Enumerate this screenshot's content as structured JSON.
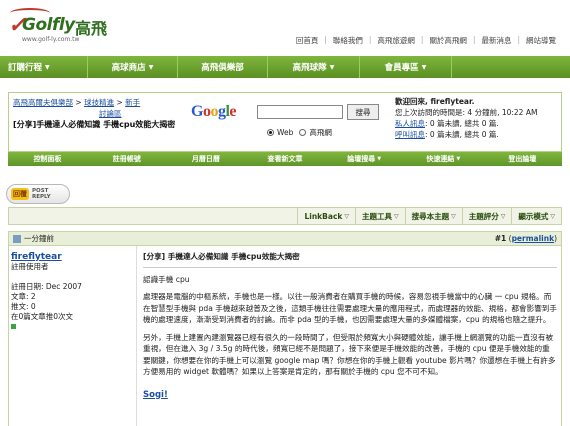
{
  "logo": {
    "word": "Golfly",
    "cjk": "高飛",
    "url": "www.golf-ly.com.tw"
  },
  "toplinks": [
    "回首頁",
    "聯絡我們",
    "高飛旅遊網",
    "關於高飛網",
    "最新消息",
    "網站導覽"
  ],
  "mainnav": [
    {
      "label": "訂購行程"
    },
    {
      "label": "高球商店"
    },
    {
      "label": "高飛俱樂部"
    },
    {
      "label": "高飛球隊"
    },
    {
      "label": "會員專區"
    }
  ],
  "breadcrumb": {
    "home": "高飛高爾夫俱樂部",
    "sep": ">",
    "forum": "球技精進",
    "section_prefix": "新手",
    "section_suffix": "討論區",
    "title": "[分享]手機達人必備知識  手機cpu效能大揭密"
  },
  "search": {
    "logo": {
      "g1": "G",
      "o1": "o",
      "o2": "o",
      "g2": "g",
      "l": "l",
      "e": "e"
    },
    "button": "搜尋",
    "query": "",
    "opt_web": "Web",
    "opt_site": "高飛網"
  },
  "user": {
    "welcome": "歡迎回來, fireflytear.",
    "last_visit": "您上次訪問的時間是: 4 分鐘前, 10:22 AM",
    "pm_label": "私人訊息",
    "pm_stats": ": 0 篇未讀, 總共 0 篇.",
    "call_label": "呼叫訊息",
    "call_stats": ": 0 篇未讀, 總共 0 篇."
  },
  "subnav": [
    "控制面板",
    "註冊帳號",
    "月曆日曆",
    "查看新文章",
    "論壇搜尋",
    "快速連結",
    "登出論壇"
  ],
  "post_reply": {
    "cjk": "回覆",
    "en1": "POST",
    "en2": "REPLY"
  },
  "thread_tools": [
    "LinkBack",
    "主題工具",
    "搜尋本主題",
    "主題評分",
    "顯示模式"
  ],
  "post": {
    "time": "一分鐘前",
    "number_prefix": "#1",
    "permalink": "permalink",
    "author": {
      "name": "fireflytear",
      "role": "註冊使用者",
      "join": "註冊日期: Dec 2007",
      "posts": "文章: 2",
      "thanks": "推文: 0",
      "thanked": "在0篇文章推0次文"
    },
    "title": "[分享] 手機達人必備知識   手機cpu效能大揭密",
    "heading": "認識手機 cpu",
    "p1": "處理器是電腦的中樞系統，手機也是一樣。以往一般消費者在購買手機的時候，容易忽視手機當中的心臟 一 cpu 規格。而在智慧型手機與 pda 手機越來越普及之後，這類手機往往需要處理大量的應用程式，而處理器的效能、規格，都會影響到手機的處理速度，漸漸受到消費者的討論。而非 pda 型的手機，也因需要處理大量的多媒體檔案，cpu 的規格也隨之提升。",
    "p2": "另外，手機上建置內建瀏覽器已經有很久的一段時間了，但受限於頻寬大小與硬體效能，讓手機上網瀏覽的功能一直沒有被重視，但在進入 3g / 3.5g 的時代後，頻寬已經不是問題了，接下來便是手機效能的改善，手機的 cpu 便是手機效能的重要關鍵，你想要在你的手機上可以瀏覽 google map 嗎？你想在你的手機上觀看 youtube 影片嗎？你還想在手機上有許多方便易用的 widget 軟體嗎？如果以上答案是肯定的，那有關於手機的 cpu 您不可不知。",
    "sign": "Sogi!"
  }
}
